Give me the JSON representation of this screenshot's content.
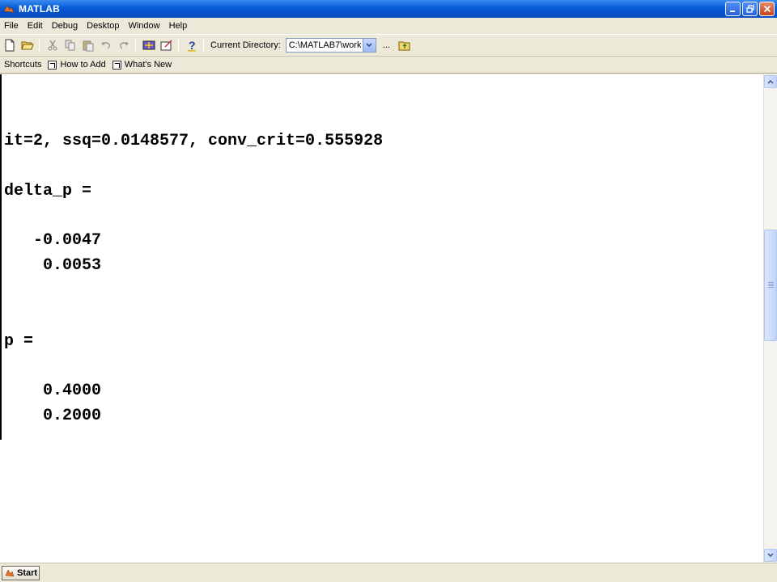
{
  "window": {
    "title": "MATLAB"
  },
  "menu": {
    "items": [
      "File",
      "Edit",
      "Debug",
      "Desktop",
      "Window",
      "Help"
    ]
  },
  "toolbar": {
    "icons": [
      "new-file-icon",
      "open-folder-icon",
      "cut-icon",
      "copy-icon",
      "paste-icon",
      "undo-icon",
      "redo-icon",
      "simulink-icon",
      "guide-icon",
      "help-icon"
    ],
    "current_directory_label": "Current Directory:",
    "current_directory_value": "C:\\MATLAB7\\work",
    "browse_label": "...",
    "up_folder_icon": "up-folder-icon"
  },
  "shortcuts": {
    "label": "Shortcuts",
    "items": [
      "How to Add",
      "What's New"
    ]
  },
  "command_window": {
    "lines": [
      "it=2, ssq=0.0148577, conv_crit=0.555928",
      "delta_p =",
      "   -0.0047",
      "    0.0053",
      "p =",
      "    0.4000",
      "    0.2000"
    ]
  },
  "statusbar": {
    "start_label": "Start"
  },
  "colors": {
    "titlebar": "#0a5fd8",
    "chrome": "#ece9d8",
    "command_bg": "#ffffff",
    "text": "#000000"
  }
}
